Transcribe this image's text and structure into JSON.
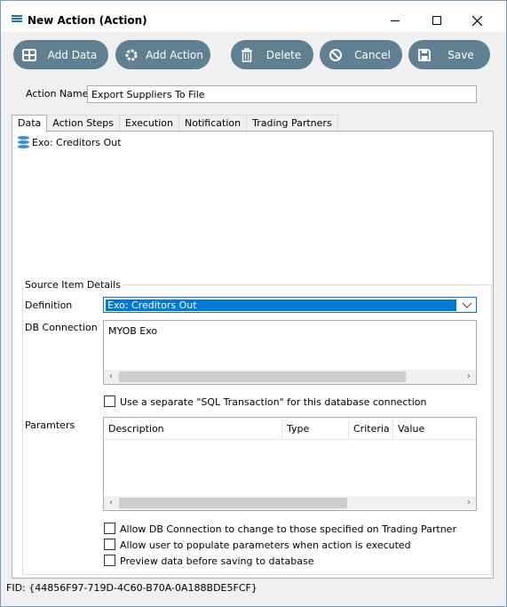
{
  "window": {
    "title": "New Action (Action)",
    "icon": "menu-lines-icon"
  },
  "toolbar": {
    "add_data": "Add Data",
    "add_action": "Add Action",
    "delete": "Delete",
    "cancel": "Cancel",
    "save": "Save"
  },
  "action_name": {
    "label": "Action Name",
    "value": "Export Suppliers To File"
  },
  "tabs": [
    {
      "label": "Data",
      "active": true
    },
    {
      "label": "Action Steps"
    },
    {
      "label": "Execution"
    },
    {
      "label": "Notification"
    },
    {
      "label": "Trading Partners"
    }
  ],
  "data_tree": {
    "item": "Exo: Creditors Out"
  },
  "source_details": {
    "legend": "Source Item Details",
    "definition_label": "Definition",
    "definition_value": "Exo: Creditors Out",
    "db_connection_label": "DB Connection",
    "db_connection_item": "MYOB Exo",
    "sql_transaction_label": "Use a separate \"SQL Transaction\" for this database connection",
    "parameters_label": "Paramters",
    "parameter_columns": [
      "Description",
      "Type",
      "Criteria",
      "Value"
    ],
    "options": [
      "Allow DB Connection to change to those specified on Trading Partner",
      "Allow user to populate parameters when action is executed",
      "Preview data before saving to database"
    ]
  },
  "fid": "FID: {44856F97-719D-4C60-B70A-0A188BDE5FCF}",
  "colors": {
    "toolbar_button": "#5f7f92",
    "selection": "#0078d7"
  }
}
